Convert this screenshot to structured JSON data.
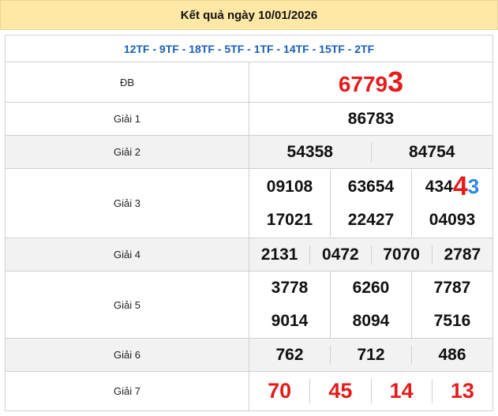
{
  "title": "Kết quả ngày 10/01/2026",
  "codes": "12TF - 9TF - 18TF - 5TF - 1TF - 14TF - 15TF - 2TF",
  "db": {
    "label": "ĐB",
    "value_head": "6779",
    "value_tail": "3"
  },
  "g1": {
    "label": "Giải 1",
    "values": [
      "86783"
    ]
  },
  "g2": {
    "label": "Giải 2",
    "values": [
      "54358",
      "84754"
    ]
  },
  "g3": {
    "label": "Giải 3",
    "values": [
      "09108",
      "63654",
      "434",
      "17021",
      "22427",
      "04093"
    ],
    "highlight_red": "4",
    "highlight_blue": "3"
  },
  "g4": {
    "label": "Giải 4",
    "values": [
      "2131",
      "0472",
      "7070",
      "2787"
    ]
  },
  "g5": {
    "label": "Giải 5",
    "values": [
      "3778",
      "6260",
      "7787",
      "9014",
      "8094",
      "7516"
    ]
  },
  "g6": {
    "label": "Giải 6",
    "values": [
      "762",
      "712",
      "486"
    ]
  },
  "g7": {
    "label": "Giải 7",
    "values": [
      "70",
      "45",
      "14",
      "13"
    ]
  },
  "colors": {
    "header_bg": "#ffe8a6",
    "codes": "#1a5fb4",
    "red": "#e51b1b",
    "blue": "#2f86e6",
    "row_alt": "#f2f2f2"
  }
}
